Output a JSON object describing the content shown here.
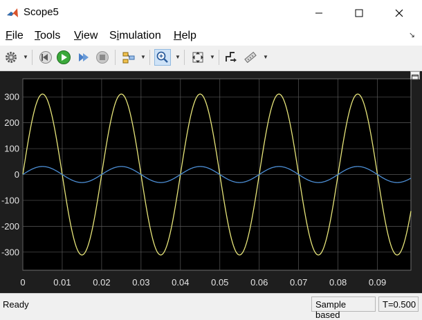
{
  "window": {
    "title": "Scope5"
  },
  "menu": {
    "items": [
      {
        "pre": "",
        "u": "F",
        "post": "ile"
      },
      {
        "pre": "",
        "u": "T",
        "post": "ools"
      },
      {
        "pre": "",
        "u": "V",
        "post": "iew"
      },
      {
        "pre": "S",
        "u": "i",
        "post": "mulation"
      },
      {
        "pre": "",
        "u": "H",
        "post": "elp"
      }
    ]
  },
  "toolbar": {
    "icons": [
      "gear-icon",
      "step-back-icon",
      "run-icon",
      "step-forward-icon",
      "stop-icon",
      "signal-select-icon",
      "zoom-in-icon",
      "fit-to-view-icon",
      "triggers-icon",
      "measurements-icon"
    ]
  },
  "chart_data": {
    "type": "line",
    "xlim": [
      0,
      0.0985
    ],
    "ylim": [
      -370,
      370
    ],
    "x_ticks": [
      0,
      0.01,
      0.02,
      0.03,
      0.04,
      0.05,
      0.06,
      0.07,
      0.08,
      0.09
    ],
    "y_ticks": [
      -300,
      -200,
      -100,
      0,
      100,
      200,
      300
    ],
    "x_tick_labels": [
      "0",
      "0.01",
      "0.02",
      "0.03",
      "0.04",
      "0.05",
      "0.06",
      "0.07",
      "0.08",
      "0.09"
    ],
    "y_tick_labels": [
      "-300",
      "-200",
      "-100",
      "0",
      "100",
      "200",
      "300"
    ],
    "grid": true,
    "series": [
      {
        "color": "#e8e67a",
        "amplitude": 311,
        "frequency_hz": 50,
        "phase": 0
      },
      {
        "color": "#4d8fd6",
        "amplitude": 31,
        "frequency_hz": 50,
        "phase": 0
      }
    ]
  },
  "status": {
    "ready": "Ready",
    "mode": "Sample based",
    "time": "T=0.500"
  }
}
